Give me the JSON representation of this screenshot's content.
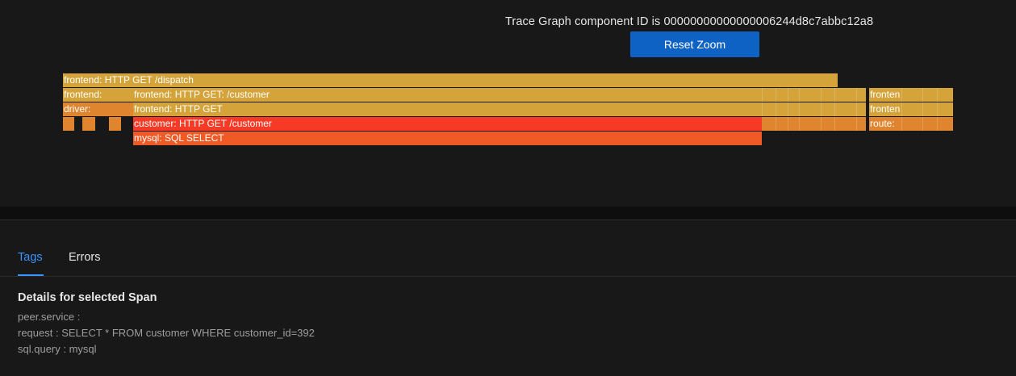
{
  "trace_graph": {
    "title": "Trace Graph component ID is 00000000000000006244d8c7abbc12a8",
    "reset_zoom_label": "Reset Zoom",
    "spans": {
      "dispatch": "frontend: HTTP GET /dispatch",
      "frontend_short": "frontend:",
      "frontend_get_customer": "frontend: HTTP GET: /customer",
      "frontend_right_1": "fronten",
      "driver": "driver:",
      "frontend_get": "frontend: HTTP GET",
      "frontend_right_2": "fronten",
      "customer_get": "customer: HTTP GET /customer",
      "route": "route:",
      "mysql_select": "mysql: SQL SELECT"
    },
    "colors": {
      "yellow": "#d4a43b",
      "orange": "#e0852f",
      "red": "#f73a26",
      "red_orange": "#f05a26"
    }
  },
  "tabs": {
    "tags_label": "Tags",
    "errors_label": "Errors",
    "active": "Tags"
  },
  "details": {
    "heading": "Details for selected Span",
    "rows": [
      "peer.service :",
      "request : SELECT * FROM customer WHERE customer_id=392",
      "sql.query : mysql"
    ]
  }
}
